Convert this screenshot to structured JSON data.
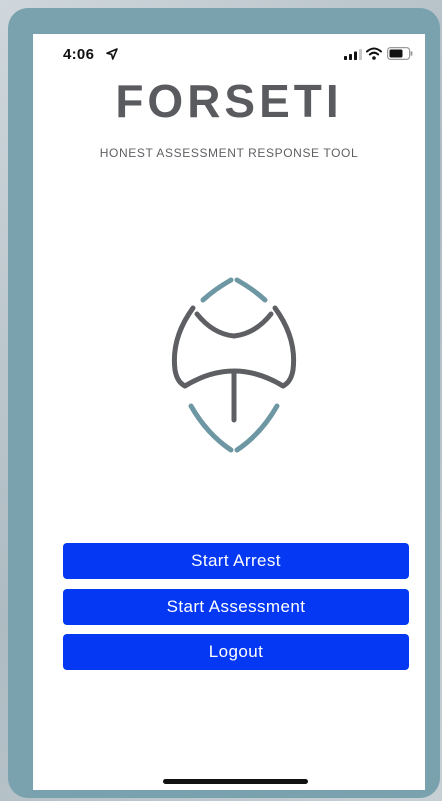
{
  "status_bar": {
    "time": "4:06",
    "icons": [
      "location-arrow-icon",
      "signal-icon",
      "wifi-icon",
      "battery-icon"
    ]
  },
  "app": {
    "title": "FORSETI",
    "subtitle": "HONEST ASSESSMENT RESPONSE TOOL",
    "logo_icon": "forseti-shield-logo",
    "colors": {
      "title": "#595b5f",
      "logo_dark": "#5e5f63",
      "logo_accent": "#6e97a4",
      "button": "#0438f3",
      "frame": "#7aa2ae"
    }
  },
  "actions": {
    "start_arrest": "Start Arrest",
    "start_assessment": "Start Assessment",
    "logout": "Logout"
  }
}
